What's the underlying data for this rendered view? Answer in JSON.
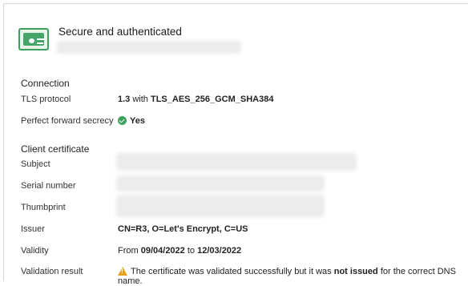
{
  "header": {
    "title": "Secure and authenticated"
  },
  "connection": {
    "section": "Connection",
    "tls": {
      "label": "TLS protocol",
      "version": "1.3",
      "with": "with",
      "cipher": "TLS_AES_256_GCM_SHA384"
    },
    "pfs": {
      "label": "Perfect forward secrecy",
      "value": "Yes"
    }
  },
  "client_certificate": {
    "section": "Client certificate",
    "subject_label": "Subject",
    "serial_label": "Serial number",
    "thumbprint_label": "Thumbprint",
    "issuer": {
      "label": "Issuer",
      "value": "CN=R3, O=Let's Encrypt, C=US"
    },
    "validity": {
      "label": "Validity",
      "from": "From",
      "start": "09/04/2022",
      "to": "to",
      "end": "12/03/2022"
    },
    "validation": {
      "label": "Validation result",
      "text_before": "The certificate was validated successfully but it was",
      "emphasis": "not issued",
      "text_after": "for the correct DNS name."
    }
  },
  "colors": {
    "success": "#3ca35d",
    "warning": "#e3a21a",
    "cert_icon": "#46a36a"
  },
  "icons": {
    "header": "certificate-icon",
    "pfs": "check-circle-icon",
    "validation": "warning-icon"
  }
}
